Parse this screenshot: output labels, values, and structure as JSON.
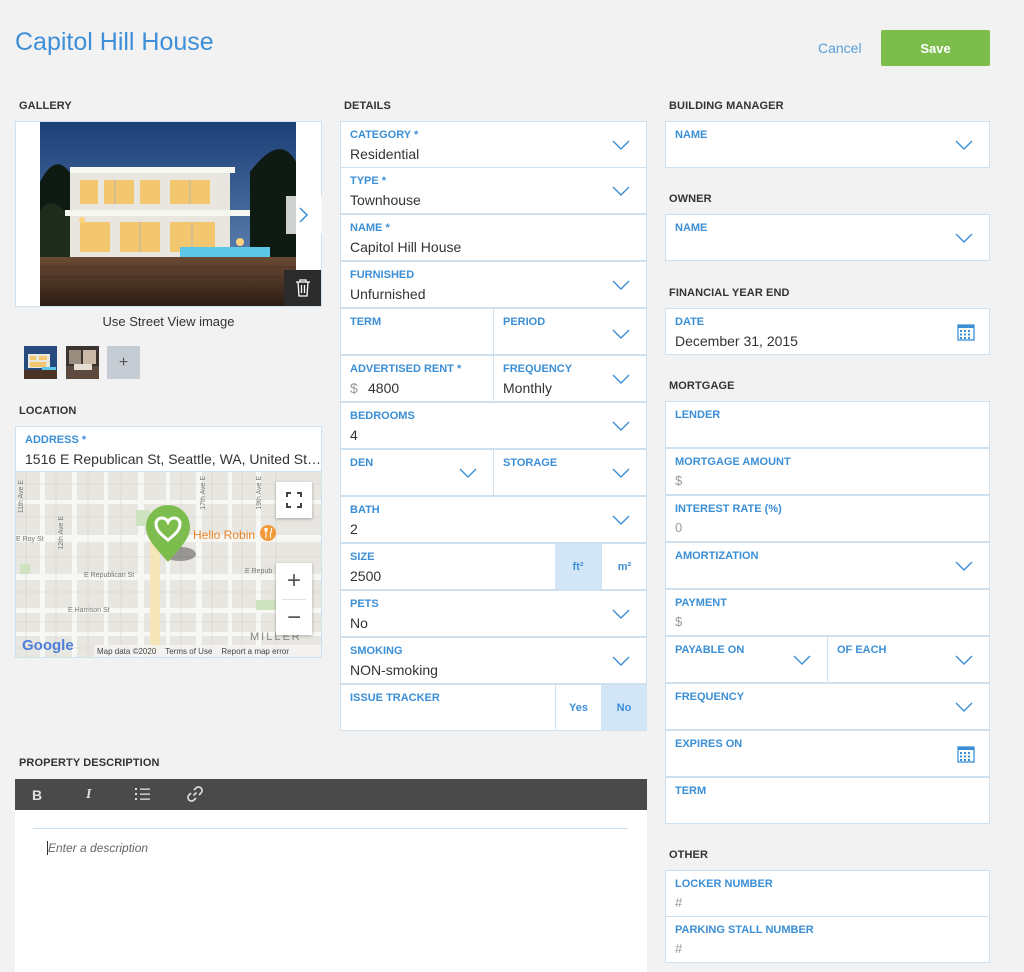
{
  "page_title": "Capitol Hill House",
  "actions": {
    "cancel": "Cancel",
    "save": "Save"
  },
  "gallery": {
    "heading": "GALLERY",
    "street_view": "Use Street View image",
    "add": "+"
  },
  "location": {
    "heading": "LOCATION",
    "address_label": "ADDRESS *",
    "address_value": "1516 E Republican St, Seattle, WA, United St…",
    "map": {
      "poi": "Hello Robin",
      "streets": [
        "11th Ave E",
        "12th Ave E",
        "E Roy St",
        "E Republican St",
        "E Harrison St",
        "17th Ave E",
        "19th Ave E",
        "E Repub",
        "MILLER"
      ],
      "logo": "Google",
      "map_data": "Map data ©2020",
      "terms": "Terms of Use",
      "report": "Report a map error",
      "zoom_in": "+",
      "zoom_out": "−"
    }
  },
  "details": {
    "heading": "DETAILS",
    "category": {
      "label": "CATEGORY *",
      "value": "Residential"
    },
    "type": {
      "label": "TYPE *",
      "value": "Townhouse"
    },
    "name": {
      "label": "NAME *",
      "value": "Capitol Hill House"
    },
    "furnished": {
      "label": "FURNISHED",
      "value": "Unfurnished"
    },
    "term": {
      "label": "TERM"
    },
    "period": {
      "label": "PERIOD"
    },
    "advertised_rent": {
      "label": "ADVERTISED RENT *",
      "currency": "$",
      "value": "4800"
    },
    "frequency": {
      "label": "FREQUENCY",
      "value": "Monthly"
    },
    "bedrooms": {
      "label": "BEDROOMS",
      "value": "4"
    },
    "den": {
      "label": "DEN"
    },
    "storage": {
      "label": "STORAGE"
    },
    "bath": {
      "label": "BATH",
      "value": "2"
    },
    "size": {
      "label": "SIZE",
      "value": "2500",
      "unit_ft": "ft²",
      "unit_m": "m²"
    },
    "pets": {
      "label": "PETS",
      "value": "No"
    },
    "smoking": {
      "label": "SMOKING",
      "value": "NON-smoking"
    },
    "issue_tracker": {
      "label": "ISSUE TRACKER",
      "yes": "Yes",
      "no": "No"
    }
  },
  "building_manager": {
    "heading": "BUILDING MANAGER",
    "name_label": "NAME"
  },
  "owner": {
    "heading": "OWNER",
    "name_label": "NAME"
  },
  "financial_year_end": {
    "heading": "FINANCIAL YEAR END",
    "date_label": "DATE",
    "date_value": "December 31, 2015"
  },
  "mortgage": {
    "heading": "MORTGAGE",
    "lender": "LENDER",
    "amount_label": "MORTGAGE AMOUNT",
    "amount_placeholder": "$",
    "rate_label": "INTEREST RATE (%)",
    "rate_placeholder": "0",
    "amortization": "AMORTIZATION",
    "payment_label": "PAYMENT",
    "payment_placeholder": "$",
    "payable_on": "PAYABLE ON",
    "of_each": "OF EACH",
    "frequency": "FREQUENCY",
    "expires_on": "EXPIRES ON",
    "term": "TERM"
  },
  "other": {
    "heading": "OTHER",
    "locker_label": "LOCKER NUMBER",
    "locker_placeholder": "#",
    "parking_label": "PARKING STALL NUMBER",
    "parking_placeholder": "#"
  },
  "property_description": {
    "heading": "PROPERTY DESCRIPTION",
    "toolbar": {
      "bold": "B",
      "italic": "I"
    },
    "placeholder": "Enter a description"
  },
  "colors": {
    "accent": "#3b8fd6",
    "save": "#7dbd4d",
    "toolbar": "#4a4a4a",
    "selected": "#d3e6f7"
  },
  "icons": [
    "chevron-right-icon",
    "trash-icon",
    "chevron-down-icon",
    "calendar-icon",
    "fullscreen-icon",
    "map-pin-icon",
    "restaurant-icon",
    "bold-icon",
    "italic-icon",
    "list-icon",
    "link-icon"
  ]
}
